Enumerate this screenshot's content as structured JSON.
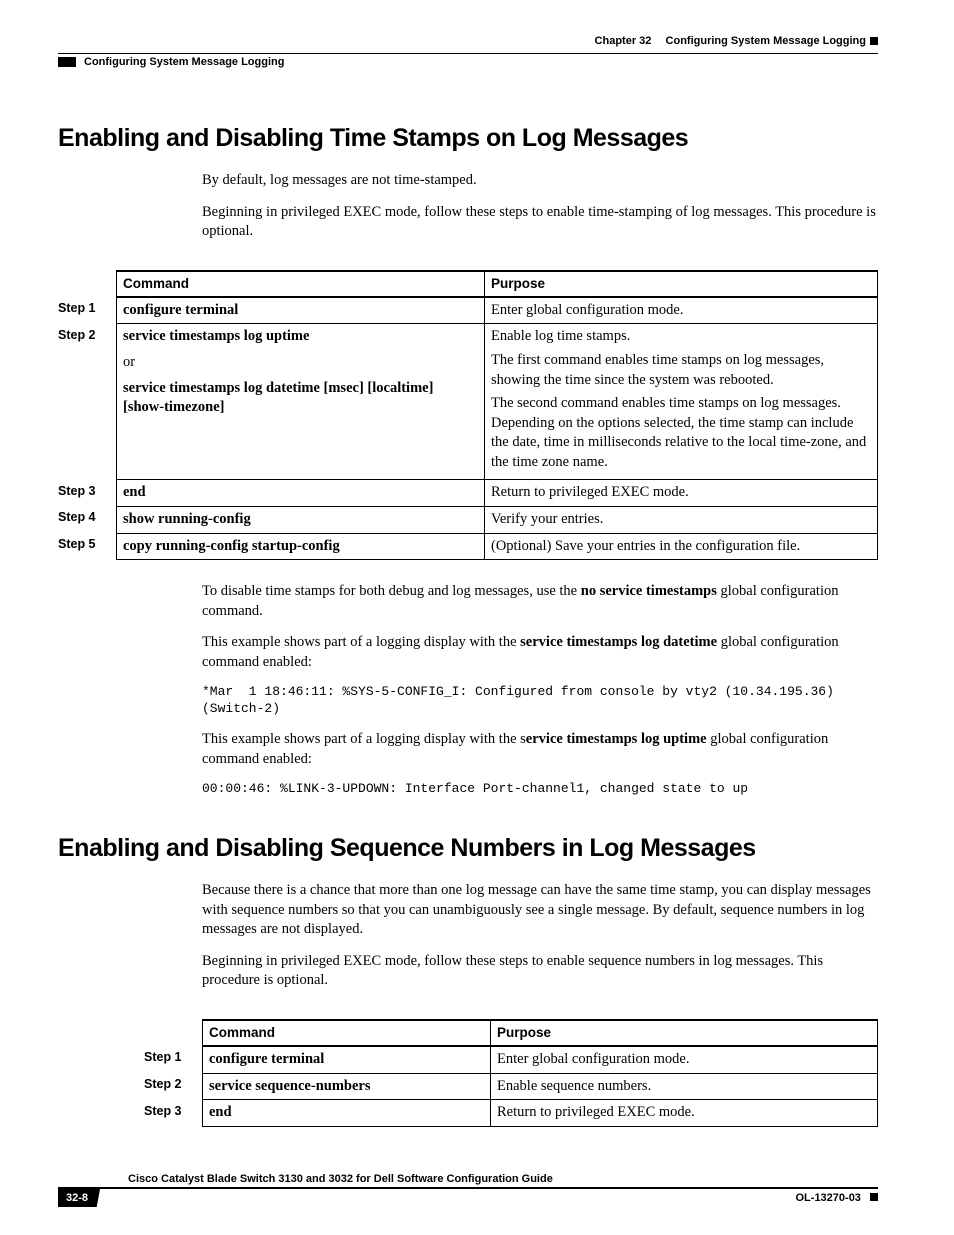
{
  "header": {
    "chapter": "Chapter 32",
    "chapter_title": "Configuring System Message Logging",
    "section": "Configuring System Message Logging"
  },
  "h1": "Enabling and Disabling Time Stamps on Log Messages",
  "p1": "By default, log messages are not time-stamped.",
  "p2": "Beginning in privileged EXEC mode, follow these steps to enable time-stamping of log messages. This procedure is optional.",
  "table1": {
    "head_command": "Command",
    "head_purpose": "Purpose",
    "rows": [
      {
        "step": "Step 1",
        "cmd": "configure terminal",
        "purpose": "Enter global configuration mode."
      },
      {
        "step": "Step 2",
        "cmd_line1": "service timestamps log uptime",
        "cmd_or": "or",
        "cmd_line2": "service timestamps log datetime [msec] [localtime] [show-timezone]",
        "purpose_line1": "Enable log time stamps.",
        "purpose_line2": "The first command enables time stamps on log messages, showing the time since the system was rebooted.",
        "purpose_line3": "The second command enables time stamps on log messages. Depending on the options selected, the time stamp can include the date, time in milliseconds relative to the local time-zone, and the time zone name."
      },
      {
        "step": "Step 3",
        "cmd": "end",
        "purpose": "Return to privileged EXEC mode."
      },
      {
        "step": "Step 4",
        "cmd": "show running-config",
        "purpose": "Verify your entries."
      },
      {
        "step": "Step 5",
        "cmd": "copy running-config startup-config",
        "purpose": "(Optional) Save your entries in the configuration file."
      }
    ]
  },
  "p3_pre": "To disable time stamps for both debug and log messages, use the ",
  "p3_bold": "no service timestamps",
  "p3_post": " global configuration command.",
  "p4_pre": "This example shows part of a logging display with the ",
  "p4_bold": "service timestamps log datetime",
  "p4_post": " global configuration command enabled:",
  "mono1": "*Mar  1 18:46:11: %SYS-5-CONFIG_I: Configured from console by vty2 (10.34.195.36) (Switch-2)",
  "p5_pre": "This example shows part of a logging display with the s",
  "p5_bold": "ervice timestamps log uptime",
  "p5_post": " global configuration command enabled:",
  "mono2": "00:00:46: %LINK-3-UPDOWN: Interface Port-channel1, changed state to up",
  "h2": "Enabling and Disabling Sequence Numbers in Log Messages",
  "p6": "Because there is a chance that more than one log message can have the same time stamp, you can display messages with sequence numbers so that you can unambiguously see a single message. By default, sequence numbers in log messages are not displayed.",
  "p7": "Beginning in privileged EXEC mode, follow these steps to enable sequence numbers in log messages. This procedure is optional.",
  "table2": {
    "head_command": "Command",
    "head_purpose": "Purpose",
    "rows": [
      {
        "step": "Step 1",
        "cmd": "configure terminal",
        "purpose": "Enter global configuration mode."
      },
      {
        "step": "Step 2",
        "cmd": "service sequence-numbers",
        "purpose": "Enable sequence numbers."
      },
      {
        "step": "Step 3",
        "cmd": "end",
        "purpose": "Return to privileged EXEC mode."
      }
    ]
  },
  "footer": {
    "title": "Cisco Catalyst Blade Switch 3130 and 3032 for Dell Software Configuration Guide",
    "page": "32-8",
    "doc": "OL-13270-03"
  }
}
